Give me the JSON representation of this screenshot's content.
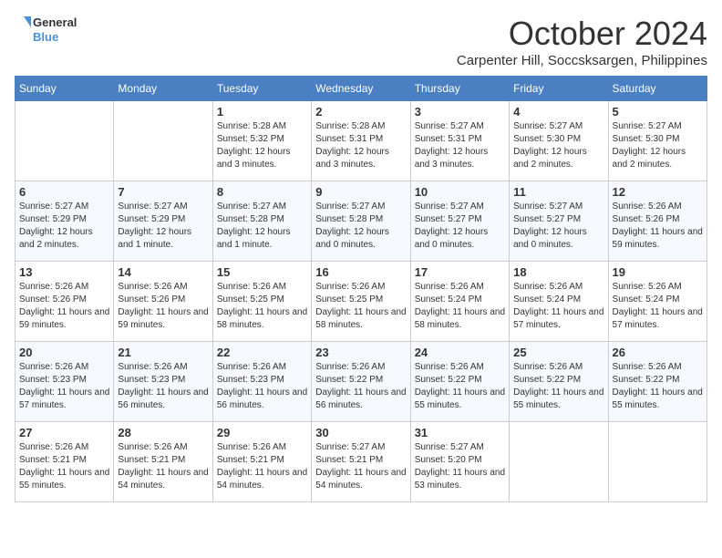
{
  "logo": {
    "general": "General",
    "blue": "Blue"
  },
  "header": {
    "month": "October 2024",
    "location": "Carpenter Hill, Soccsksargen, Philippines"
  },
  "weekdays": [
    "Sunday",
    "Monday",
    "Tuesday",
    "Wednesday",
    "Thursday",
    "Friday",
    "Saturday"
  ],
  "weeks": [
    [
      {
        "day": "",
        "info": ""
      },
      {
        "day": "",
        "info": ""
      },
      {
        "day": "1",
        "info": "Sunrise: 5:28 AM\nSunset: 5:32 PM\nDaylight: 12 hours and 3 minutes."
      },
      {
        "day": "2",
        "info": "Sunrise: 5:28 AM\nSunset: 5:31 PM\nDaylight: 12 hours and 3 minutes."
      },
      {
        "day": "3",
        "info": "Sunrise: 5:27 AM\nSunset: 5:31 PM\nDaylight: 12 hours and 3 minutes."
      },
      {
        "day": "4",
        "info": "Sunrise: 5:27 AM\nSunset: 5:30 PM\nDaylight: 12 hours and 2 minutes."
      },
      {
        "day": "5",
        "info": "Sunrise: 5:27 AM\nSunset: 5:30 PM\nDaylight: 12 hours and 2 minutes."
      }
    ],
    [
      {
        "day": "6",
        "info": "Sunrise: 5:27 AM\nSunset: 5:29 PM\nDaylight: 12 hours and 2 minutes."
      },
      {
        "day": "7",
        "info": "Sunrise: 5:27 AM\nSunset: 5:29 PM\nDaylight: 12 hours and 1 minute."
      },
      {
        "day": "8",
        "info": "Sunrise: 5:27 AM\nSunset: 5:28 PM\nDaylight: 12 hours and 1 minute."
      },
      {
        "day": "9",
        "info": "Sunrise: 5:27 AM\nSunset: 5:28 PM\nDaylight: 12 hours and 0 minutes."
      },
      {
        "day": "10",
        "info": "Sunrise: 5:27 AM\nSunset: 5:27 PM\nDaylight: 12 hours and 0 minutes."
      },
      {
        "day": "11",
        "info": "Sunrise: 5:27 AM\nSunset: 5:27 PM\nDaylight: 12 hours and 0 minutes."
      },
      {
        "day": "12",
        "info": "Sunrise: 5:26 AM\nSunset: 5:26 PM\nDaylight: 11 hours and 59 minutes."
      }
    ],
    [
      {
        "day": "13",
        "info": "Sunrise: 5:26 AM\nSunset: 5:26 PM\nDaylight: 11 hours and 59 minutes."
      },
      {
        "day": "14",
        "info": "Sunrise: 5:26 AM\nSunset: 5:26 PM\nDaylight: 11 hours and 59 minutes."
      },
      {
        "day": "15",
        "info": "Sunrise: 5:26 AM\nSunset: 5:25 PM\nDaylight: 11 hours and 58 minutes."
      },
      {
        "day": "16",
        "info": "Sunrise: 5:26 AM\nSunset: 5:25 PM\nDaylight: 11 hours and 58 minutes."
      },
      {
        "day": "17",
        "info": "Sunrise: 5:26 AM\nSunset: 5:24 PM\nDaylight: 11 hours and 58 minutes."
      },
      {
        "day": "18",
        "info": "Sunrise: 5:26 AM\nSunset: 5:24 PM\nDaylight: 11 hours and 57 minutes."
      },
      {
        "day": "19",
        "info": "Sunrise: 5:26 AM\nSunset: 5:24 PM\nDaylight: 11 hours and 57 minutes."
      }
    ],
    [
      {
        "day": "20",
        "info": "Sunrise: 5:26 AM\nSunset: 5:23 PM\nDaylight: 11 hours and 57 minutes."
      },
      {
        "day": "21",
        "info": "Sunrise: 5:26 AM\nSunset: 5:23 PM\nDaylight: 11 hours and 56 minutes."
      },
      {
        "day": "22",
        "info": "Sunrise: 5:26 AM\nSunset: 5:23 PM\nDaylight: 11 hours and 56 minutes."
      },
      {
        "day": "23",
        "info": "Sunrise: 5:26 AM\nSunset: 5:22 PM\nDaylight: 11 hours and 56 minutes."
      },
      {
        "day": "24",
        "info": "Sunrise: 5:26 AM\nSunset: 5:22 PM\nDaylight: 11 hours and 55 minutes."
      },
      {
        "day": "25",
        "info": "Sunrise: 5:26 AM\nSunset: 5:22 PM\nDaylight: 11 hours and 55 minutes."
      },
      {
        "day": "26",
        "info": "Sunrise: 5:26 AM\nSunset: 5:22 PM\nDaylight: 11 hours and 55 minutes."
      }
    ],
    [
      {
        "day": "27",
        "info": "Sunrise: 5:26 AM\nSunset: 5:21 PM\nDaylight: 11 hours and 55 minutes."
      },
      {
        "day": "28",
        "info": "Sunrise: 5:26 AM\nSunset: 5:21 PM\nDaylight: 11 hours and 54 minutes."
      },
      {
        "day": "29",
        "info": "Sunrise: 5:26 AM\nSunset: 5:21 PM\nDaylight: 11 hours and 54 minutes."
      },
      {
        "day": "30",
        "info": "Sunrise: 5:27 AM\nSunset: 5:21 PM\nDaylight: 11 hours and 54 minutes."
      },
      {
        "day": "31",
        "info": "Sunrise: 5:27 AM\nSunset: 5:20 PM\nDaylight: 11 hours and 53 minutes."
      },
      {
        "day": "",
        "info": ""
      },
      {
        "day": "",
        "info": ""
      }
    ]
  ]
}
